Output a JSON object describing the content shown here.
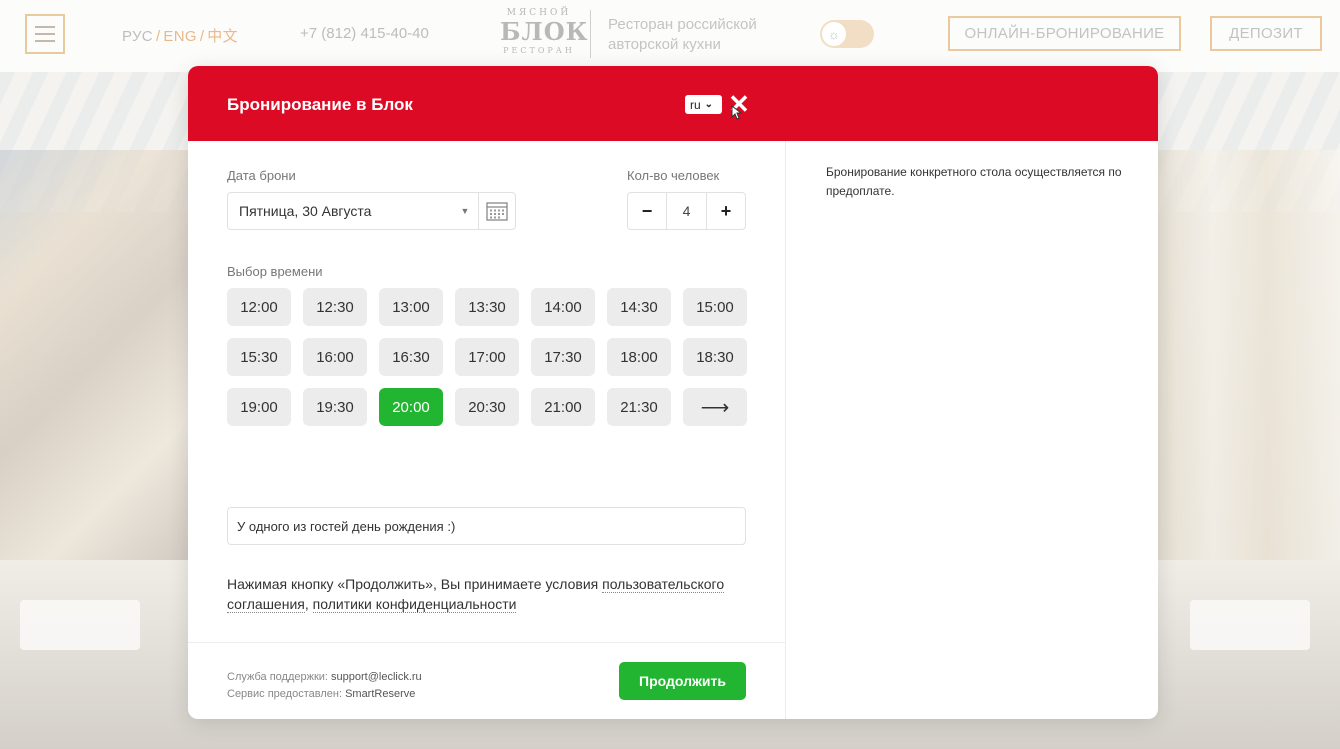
{
  "header": {
    "langs": [
      "РУС",
      "ENG",
      "中文"
    ],
    "phone": "+7 (812) 415-40-40",
    "logo": {
      "line1": "МЯСНОЙ",
      "line2": "БЛОК",
      "line3": "РЕСТОРАН"
    },
    "tagline": "Ресторан российской авторской кухни",
    "online_booking_label": "ОНЛАЙН-БРОНИРОВАНИЕ",
    "deposit_label": "ДЕПОЗИТ"
  },
  "modal": {
    "title": "Бронирование в Блок",
    "lang_value": "ru",
    "date_label": "Дата брони",
    "date_value": "Пятница, 30 Августа",
    "guests_label": "Кол-во человек",
    "guests_minus": "−",
    "guests_value": "4",
    "guests_plus": "+",
    "time_label": "Выбор времени",
    "time_slots": [
      "12:00",
      "12:30",
      "13:00",
      "13:30",
      "14:00",
      "14:30",
      "15:00",
      "15:30",
      "16:00",
      "16:30",
      "17:00",
      "17:30",
      "18:00",
      "18:30",
      "19:00",
      "19:30",
      "20:00",
      "20:30",
      "21:00",
      "21:30"
    ],
    "selected_slot": "20:00",
    "next_arrow": "⟶",
    "comment_value": "У одного из гостей день рождения :)",
    "terms_prefix": "Нажимая кнопку «Продолжить», Вы принимаете условия ",
    "terms_link1": "пользовательского соглашения",
    "terms_sep": ", ",
    "terms_link2": "политики конфиденциальности",
    "support_label": "Служба поддержки: ",
    "support_value": "support@leclick.ru",
    "service_label": "Сервис предоставлен: ",
    "service_value": "SmartReserve",
    "continue_label": "Продолжить",
    "info_text": "Бронирование конкретного стола осуществляется по предоплате."
  },
  "colors": {
    "header_red": "#dd0a25",
    "selected_green": "#22b531",
    "accent_gold": "#e9b98a"
  }
}
